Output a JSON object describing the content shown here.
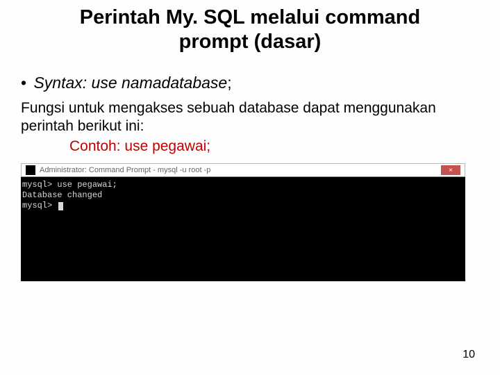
{
  "title_line1": "Perintah My. SQL melalui command",
  "title_line2": "prompt (dasar)",
  "bullet_prefix": "•",
  "syntax_label": "Syntax: use namadatabase",
  "syntax_semicolon": ";",
  "description": "Fungsi untuk mengakses sebuah database dapat menggunakan perintah berikut ini:",
  "example": "Contoh: use pegawai;",
  "terminal": {
    "window_title": "Administrator: Command Prompt - mysql -u root -p",
    "lines": [
      "mysql> use pegawai;",
      "Database changed",
      "mysql> "
    ],
    "close_label": "×"
  },
  "page_number": "10"
}
